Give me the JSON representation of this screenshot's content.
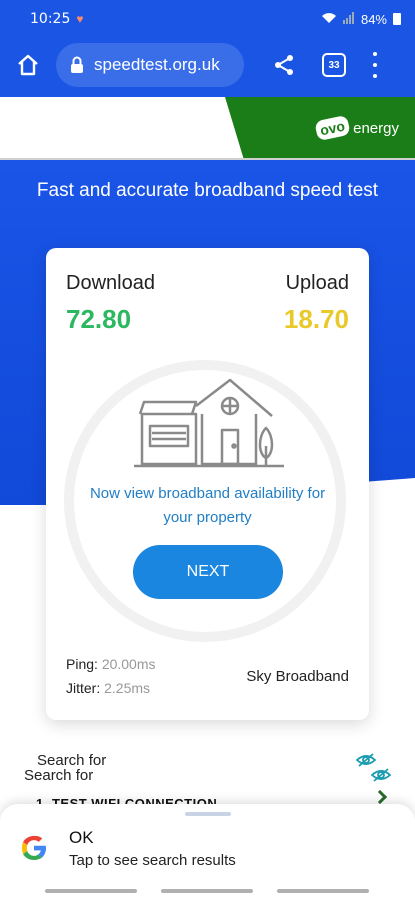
{
  "status_bar": {
    "time": "10:25",
    "battery": "84%"
  },
  "browser": {
    "url": "speedtest.org.uk",
    "tab_count": "33"
  },
  "ad": {
    "brand_word": "energy",
    "brand_mark": "ovo"
  },
  "page": {
    "tagline": "Fast and accurate broadband speed test"
  },
  "results": {
    "download_label": "Download",
    "download_value": "72.80",
    "upload_label": "Upload",
    "upload_value": "18.70",
    "availability_text": "Now view broadband availability for your property",
    "next_label": "NEXT",
    "ping_label": "Ping:",
    "ping_value": "20.00ms",
    "jitter_label": "Jitter:",
    "jitter_value": "2.25ms",
    "provider": "Sky Broadband"
  },
  "search_hints": {
    "line1": "Search for",
    "line2": "Search for",
    "peek_text": "1. TEST WIFI CONNECTION"
  },
  "bottom_sheet": {
    "title": "OK",
    "subtitle": "Tap to see search results"
  },
  "colors": {
    "brand_blue": "#1b55e3",
    "download_green": "#2bb860",
    "upload_yellow": "#e9c92a",
    "button_blue": "#1b86e0",
    "ovo_green": "#1a7d17"
  }
}
